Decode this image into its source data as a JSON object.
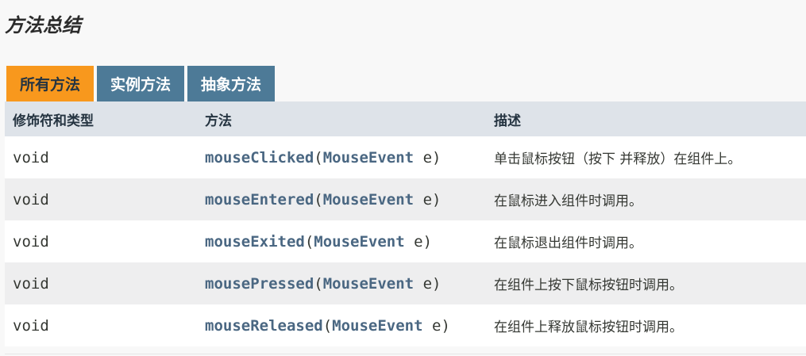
{
  "title": "方法总结",
  "tabs": [
    {
      "label": "所有方法",
      "active": true
    },
    {
      "label": "实例方法",
      "active": false
    },
    {
      "label": "抽象方法",
      "active": false
    }
  ],
  "table": {
    "headers": [
      "修饰符和类型",
      "方法",
      "描述"
    ],
    "rows": [
      {
        "modifier": "void",
        "method": "mouseClicked",
        "paren_open": "(",
        "param_type": "MouseEvent",
        "param_rest": " e)",
        "desc": "单击鼠标按钮（按下 并释放）在组件上。"
      },
      {
        "modifier": "void",
        "method": "mouseEntered",
        "paren_open": "(",
        "param_type": "MouseEvent",
        "param_rest": " e)",
        "desc": "在鼠标进入组件时调用。"
      },
      {
        "modifier": "void",
        "method": "mouseExited",
        "paren_open": "(",
        "param_type": "MouseEvent",
        "param_rest": " e)",
        "desc": "在鼠标退出组件时调用。"
      },
      {
        "modifier": "void",
        "method": "mousePressed",
        "paren_open": "(",
        "param_type": "MouseEvent",
        "param_rest": " e)",
        "desc": "在组件上按下鼠标按钮时调用。"
      },
      {
        "modifier": "void",
        "method": "mouseReleased",
        "paren_open": "(",
        "param_type": "MouseEvent",
        "param_rest": " e)",
        "desc": "在组件上释放鼠标按钮时调用。"
      }
    ]
  },
  "colors": {
    "tab_active": "#f8981d",
    "tab_inactive": "#4d7a97",
    "header_bg": "#dee3e9",
    "link": "#4a6782"
  }
}
